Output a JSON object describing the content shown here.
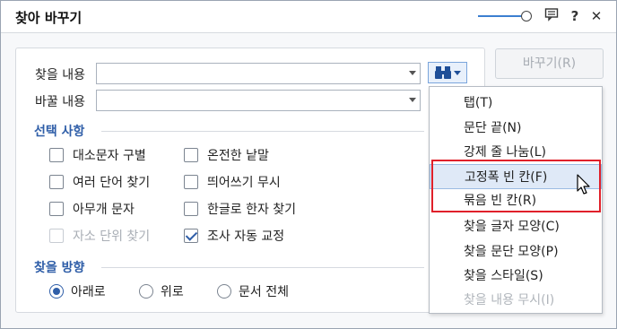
{
  "window": {
    "title": "찾아 바꾸기",
    "titlebar_icons": [
      "opacity-slider",
      "comment-icon",
      "help-icon",
      "close-icon"
    ],
    "help_glyph": "?",
    "close_glyph": "✕"
  },
  "find": {
    "label": "찾을 내용",
    "value": ""
  },
  "replace": {
    "label": "바꿀 내용",
    "value": ""
  },
  "replace_button": {
    "label": "바꾸기(R)"
  },
  "options": {
    "heading": "선택 사항",
    "items": [
      {
        "label": "대소문자 구별",
        "checked": false,
        "disabled": false
      },
      {
        "label": "온전한 낱말",
        "checked": false,
        "disabled": false
      },
      {
        "label": "여러 단어 찾기",
        "checked": false,
        "disabled": false
      },
      {
        "label": "띄어쓰기 무시",
        "checked": false,
        "disabled": false
      },
      {
        "label": "아무개 문자",
        "checked": false,
        "disabled": false
      },
      {
        "label": "한글로 한자 찾기",
        "checked": false,
        "disabled": false
      },
      {
        "label": "자소 단위 찾기",
        "checked": false,
        "disabled": true
      },
      {
        "label": "조사 자동 교정",
        "checked": true,
        "disabled": false
      }
    ]
  },
  "direction": {
    "heading": "찾을 방향",
    "items": [
      {
        "label": "아래로",
        "selected": true
      },
      {
        "label": "위로",
        "selected": false
      },
      {
        "label": "문서 전체",
        "selected": false
      }
    ]
  },
  "menu": {
    "items": [
      {
        "label": "탭(T)"
      },
      {
        "label": "문단 끝(N)"
      },
      {
        "label": "강제 줄 나눔(L)"
      },
      {
        "label": "고정폭 빈 칸(F)",
        "highlighted": true
      },
      {
        "label": "묶음 빈 칸(R)"
      },
      {
        "label": "찾을 글자 모양(C)"
      },
      {
        "label": "찾을 문단 모양(P)"
      },
      {
        "label": "찾을 스타일(S)"
      },
      {
        "label": "찾을 내용 무시(I)",
        "disabled": true
      }
    ]
  },
  "colors": {
    "accent": "#2f5ea8",
    "highlight_box": "#e0202a"
  }
}
